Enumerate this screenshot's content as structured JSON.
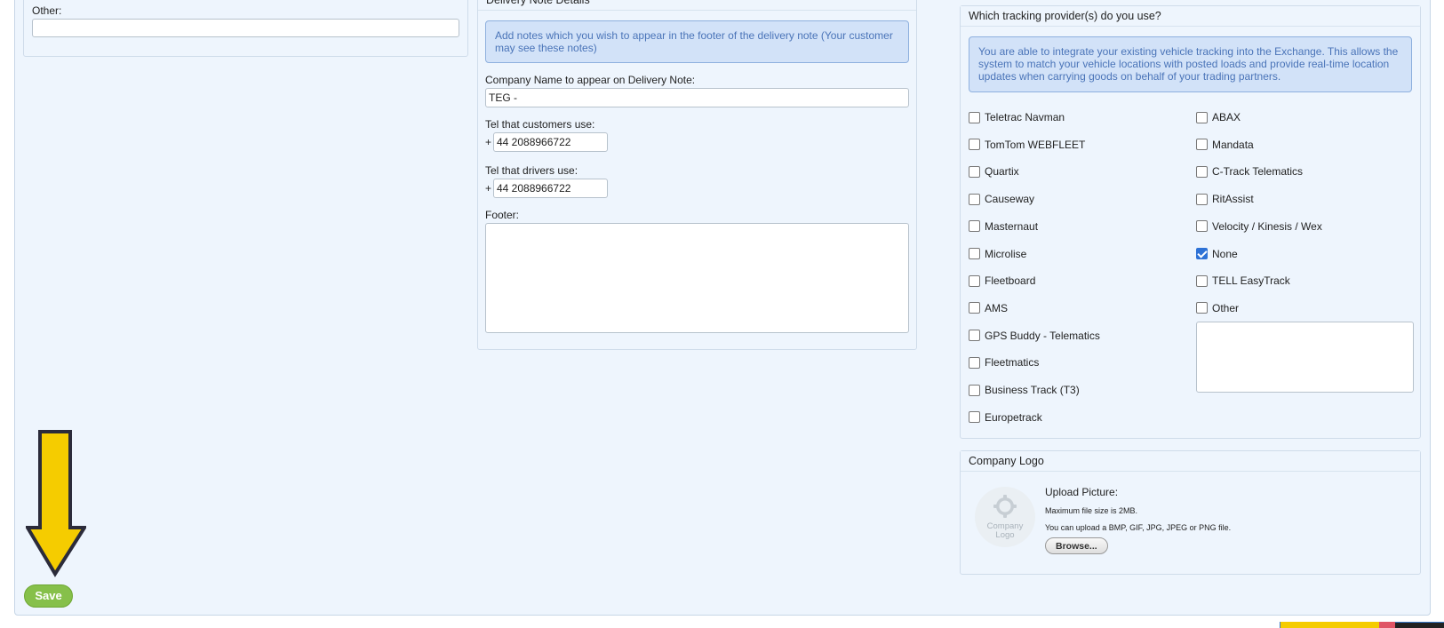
{
  "left_panel": {
    "other_label": "Other:",
    "other_value": ""
  },
  "delivery_note": {
    "title": "Delivery Note Details",
    "info": "Add notes which you wish to appear in the footer of the delivery note (Your customer may see these notes)",
    "company_label": "Company Name to appear on Delivery Note:",
    "company_value": "TEG -",
    "tel_customers_label": "Tel that customers use:",
    "tel_customers_prefix": "+",
    "tel_customers_value": "44 2088966722",
    "tel_drivers_label": "Tel that drivers use:",
    "tel_drivers_prefix": "+",
    "tel_drivers_value": "44 2088966722",
    "footer_label": "Footer:",
    "footer_value": ""
  },
  "tracking": {
    "title": "Which tracking provider(s) do you use?",
    "info": "You are able to integrate your existing vehicle tracking into the Exchange. This allows the system to match your vehicle locations with posted loads and provide real-time location updates when carrying goods on behalf of your trading partners.",
    "col1": [
      {
        "label": "Teletrac Navman",
        "checked": false
      },
      {
        "label": "TomTom WEBFLEET",
        "checked": false
      },
      {
        "label": "Quartix",
        "checked": false
      },
      {
        "label": "Causeway",
        "checked": false
      },
      {
        "label": "Masternaut",
        "checked": false
      },
      {
        "label": "Microlise",
        "checked": false
      },
      {
        "label": "Fleetboard",
        "checked": false
      },
      {
        "label": "AMS",
        "checked": false
      },
      {
        "label": "GPS Buddy - Telematics",
        "checked": false
      },
      {
        "label": "Fleetmatics",
        "checked": false
      },
      {
        "label": "Business Track (T3)",
        "checked": false
      },
      {
        "label": "Europetrack",
        "checked": false
      }
    ],
    "col2": [
      {
        "label": "ABAX",
        "checked": false
      },
      {
        "label": "Mandata",
        "checked": false
      },
      {
        "label": "C-Track Telematics",
        "checked": false
      },
      {
        "label": "RitAssist",
        "checked": false
      },
      {
        "label": "Velocity / Kinesis / Wex",
        "checked": false
      },
      {
        "label": "None",
        "checked": true
      },
      {
        "label": "TELL EasyTrack",
        "checked": false
      },
      {
        "label": "Other",
        "checked": false
      }
    ],
    "other_value": ""
  },
  "company_logo": {
    "title": "Company Logo",
    "placeholder_text": "Company Logo",
    "upload_label": "Upload Picture:",
    "max_size": "Maximum file size is 2MB.",
    "formats": "You can upload a BMP, GIF, JPG, JPEG or PNG file.",
    "browse_label": "Browse..."
  },
  "save_label": "Save",
  "colors": {
    "accent_green": "#86c04a",
    "arrow_yellow": "#f5cc00",
    "checkbox_blue": "#2e72d6",
    "info_bg": "#d2e2f8"
  }
}
